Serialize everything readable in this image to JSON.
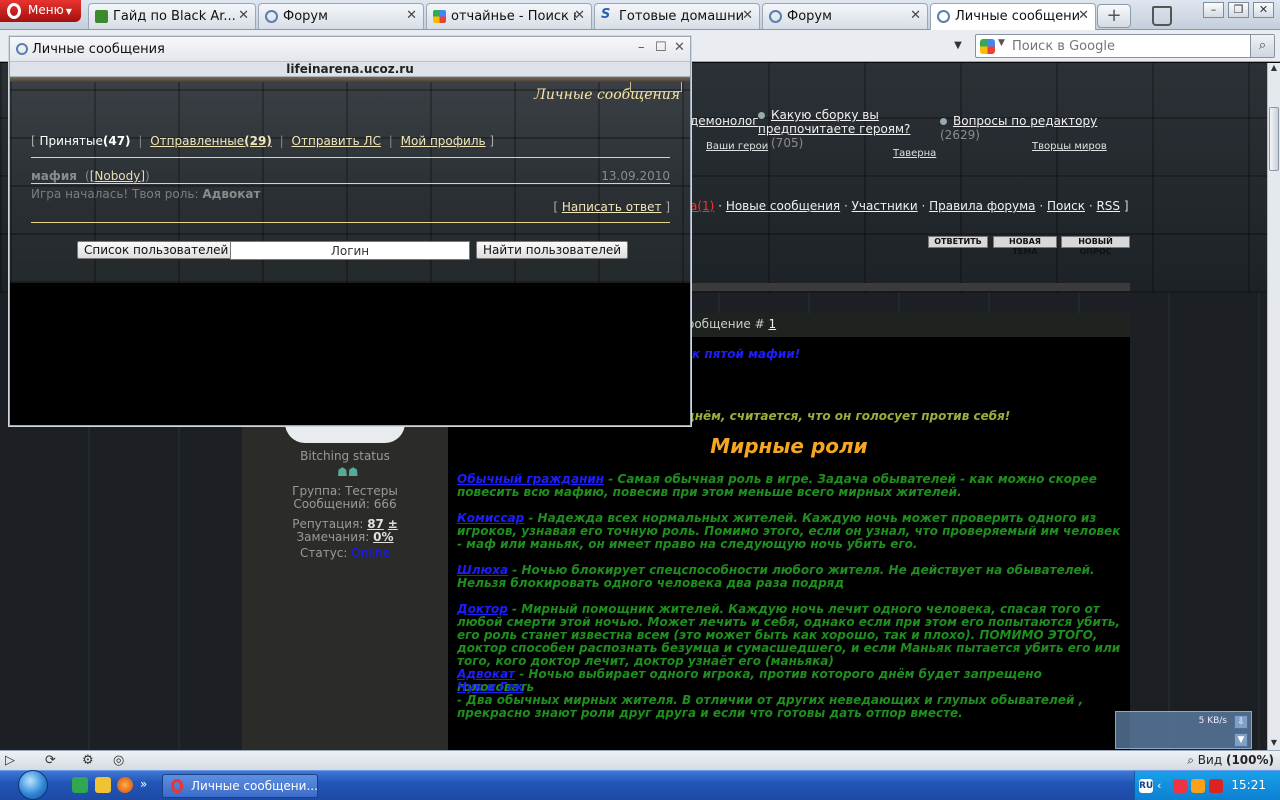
{
  "browser": {
    "menu_label": "Меню",
    "tabs": [
      {
        "label": "Гайд по Black Ar..."
      },
      {
        "label": "Форум"
      },
      {
        "label": "отчайнье - Поиск в..."
      },
      {
        "label": "Готовые домашни..."
      },
      {
        "label": "Форум"
      },
      {
        "label": "Личные сообщения"
      }
    ],
    "new_tab_label": "+",
    "search_placeholder": "Поиск в Google"
  },
  "forum": {
    "topics": [
      {
        "title": "демонолог"
      },
      {
        "title": "Какую сборку вы предпочитаете героям?",
        "count": "(705)"
      },
      {
        "title": "Вопросы по редактору",
        "count": "(2629)"
      }
    ],
    "subforums": [
      "Ваши герои",
      "Таверна",
      "Творцы миров"
    ],
    "nav": {
      "pm_count": "а(1)",
      "new_messages": "Новые сообщения",
      "members": "Участники",
      "rules": "Правила форума",
      "search": "Поиск",
      "rss": "RSS"
    },
    "buttons": {
      "reply": "ОТВЕТИТЬ",
      "new_topic": "НОВАЯ ТЕМА",
      "new_poll": "НОВЫЙ ОПРОС"
    },
    "post_header_prefix": "ообщение #",
    "post_number": "1",
    "user": {
      "status_text": "Bitching status",
      "group": "Группа: Тестеры",
      "messages": "Сообщений: 666",
      "reputation_label": "Репутация:",
      "reputation_value": "87",
      "reputation_sign": "±",
      "warnings_label": "Замечания:",
      "warnings_value": "0%",
      "status_label": "Статус:",
      "status_value": "Online"
    },
    "post": {
      "line_top": "к пятой мафии!",
      "line_self": "днём, считается, что он голосует против себя!",
      "heading": "Мирные роли",
      "roles": [
        {
          "name": "Обычный гражданин",
          "text": " - Самая обычная роль в игре. Задача обывателей - как можно скорее повесить всю мафию, повесив при этом меньше всего мирных жителей."
        },
        {
          "name": "Комиссар",
          "text": " - Надежда всех нормальных жителей. Каждую ночь может проверить одного из игроков, узнавая его точную роль. Помимо этого, если он узнал, что проверяемый им человек - маф или маньяк, он имеет право на следующую ночь убить его."
        },
        {
          "name": "Шлюха",
          "text": " - Ночью блокирует спецспособности любого жителя. Не действует на обывателей. Нельзя блокировать одного человека два раза подряд"
        },
        {
          "name": "Доктор",
          "text": " - Мирный помощник жителей. Каждую ночь лечит одного человека, спасая того от любой смерти этой ночью. Может лечить и себя, однако если при этом его попытаются убить, его роль станет известна всем (это может быть как хорошо, так и плохо). ПОМИМО ЭТОГО, доктор способен распознать безумца и сумасшедшего, и если Маньяк пытается убить его или того, кого доктор лечит, доктор узнаёт его (маньяка)"
        },
        {
          "name": "Адвокат",
          "text": " - Ночью выбирает одного игрока, против которого днём будет запрещено голосовать"
        },
        {
          "name": "Чук и Гек",
          "text": ""
        },
        {
          "name": "",
          "text": "- Два обычных мирных жителя. В отличии от других неведающих и глупых обывателей , прекрасно знают роли друг друга и если что готовы дать отпор вместе."
        }
      ]
    }
  },
  "speed_widget": {
    "rate": "5 KB/s"
  },
  "statusbar": {
    "zoom_label": "Вид",
    "zoom_value": "(100%)"
  },
  "taskbar": {
    "task_label": "Личные сообщени...",
    "clock": "15:21",
    "lang": "RU"
  },
  "popup": {
    "window_title": "Личные сообщения",
    "url": "lifeinarena.ucoz.ru",
    "header_title": "Личные сообщения",
    "nav": {
      "received_label": "Принятые",
      "received_count": "(47)",
      "sent_label": "Отправленные",
      "sent_count": "(29)",
      "send_pm": "Отправить ЛС",
      "profile": "Мой профиль"
    },
    "message": {
      "subject": "мафия",
      "from": "[Nobody]",
      "date": "13.09.2010",
      "body_prefix": "Игра началась! Твоя роль:",
      "body_role": "Адвокат"
    },
    "reply_link": "Написать ответ",
    "user_list_button": "Список пользователей",
    "login_field": "Логин",
    "find_button": "Найти пользователей"
  }
}
